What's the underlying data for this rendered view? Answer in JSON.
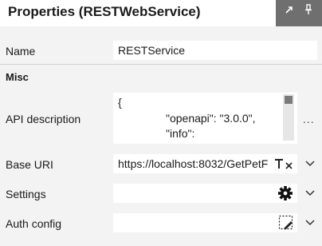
{
  "panel": {
    "title": "Properties (RESTWebService)",
    "pin_icon": "pin-icon",
    "expand_icon": "expand-icon"
  },
  "fields": {
    "name": {
      "label": "Name",
      "value": "RESTService"
    },
    "section_misc": "Misc",
    "api_description": {
      "label": "API description",
      "lines": [
        "{",
        "\"openapi\": \"3.0.0\",",
        "\"info\":"
      ],
      "more_label": "..."
    },
    "base_uri": {
      "label": "Base URI",
      "value": "https://localhost:8032/GetPetF"
    },
    "settings": {
      "label": "Settings",
      "value": ""
    },
    "auth_config": {
      "label": "Auth config",
      "value": ""
    }
  },
  "colors": {
    "panel_bg": "#f3f3f3",
    "title_tools_bg": "#6f6f6f",
    "input_bg": "#ffffff"
  }
}
